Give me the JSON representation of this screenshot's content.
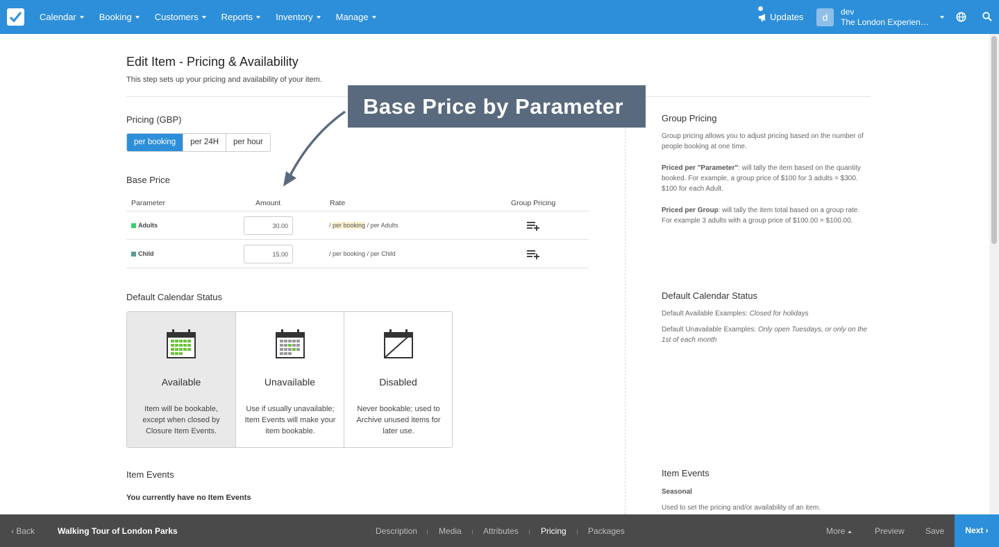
{
  "colors": {
    "brand": "#2d8fd9",
    "callout_bg": "#5a6a7e",
    "adults_swatch": "#37d16c",
    "child_swatch": "#5a9b9b",
    "bottom_bar": "#4a4a4a"
  },
  "nav": {
    "items": [
      "Calendar",
      "Booking",
      "Customers",
      "Reports",
      "Inventory",
      "Manage"
    ],
    "updates": "Updates",
    "user_initial": "d",
    "user_name": "dev",
    "user_org": "The London Experience Ltd",
    "icons": [
      "checkmark-logo-icon",
      "megaphone-icon",
      "globe-icon",
      "search-icon"
    ]
  },
  "page": {
    "title": "Edit Item - Pricing & Availability",
    "subtitle": "This step sets up your pricing and availability of your item."
  },
  "callout": "Base Price by Parameter",
  "pricing": {
    "heading": "Pricing (GBP)",
    "options": [
      "per booking",
      "per 24H",
      "per hour"
    ],
    "selected": "per booking"
  },
  "base_price": {
    "heading": "Base Price",
    "columns": [
      "Parameter",
      "Amount",
      "Rate",
      "Group Pricing"
    ],
    "rows": [
      {
        "name": "Adults",
        "amount": "30.00",
        "rate_prefix": "/ ",
        "rate_unit": "per booking",
        "rate_suffix": " / per Adults"
      },
      {
        "name": "Child",
        "amount": "15.00",
        "rate_prefix": "/ ",
        "rate_unit": "per booking",
        "rate_suffix": " / per Child"
      }
    ]
  },
  "calendar_status": {
    "heading": "Default Calendar Status",
    "cards": [
      {
        "title": "Available",
        "desc": "Item will be bookable, except when closed by Closure Item Events."
      },
      {
        "title": "Unavailable",
        "desc": "Use if usually unavailable; Item Events will make your item bookable."
      },
      {
        "title": "Disabled",
        "desc": "Never bookable; used to Archive unused items for later use."
      }
    ]
  },
  "item_events": {
    "heading": "Item Events",
    "empty": "You currently have no Item Events"
  },
  "sidebar": {
    "group_pricing": {
      "heading": "Group Pricing",
      "intro": "Group pricing allows you to adjust pricing based on the number of people booking at one time.",
      "param_label": "Priced per \"Parameter\"",
      "param_text": ": will tally the item based on the quantity booked. For example, a group price of $100 for 3 adults = $300. $100 for each Adult.",
      "group_label": "Priced per Group",
      "group_text": ": will tally the item total based on a group rate. For example 3 adults with a group price of $100.00 = $100.00."
    },
    "calendar_status": {
      "heading": "Default Calendar Status",
      "avail_label": "Default Available Examples: ",
      "avail_example": "Closed for holidays",
      "unavail_label": "Default Unavailable Examples: ",
      "unavail_example": "Only open Tuesdays, or only on the 1st of each month"
    },
    "item_events": {
      "heading": "Item Events",
      "sub": "Seasonal",
      "text": "Used to set the pricing and/or availability of an item."
    }
  },
  "bottom": {
    "back": "‹ Back",
    "item_name": "Walking Tour of London Parks",
    "tabs": [
      "Description",
      "Media",
      "Attributes",
      "Pricing",
      "Packages"
    ],
    "active_tab": "Pricing",
    "more": "More",
    "preview": "Preview",
    "save": "Save",
    "next": "Next ›"
  }
}
